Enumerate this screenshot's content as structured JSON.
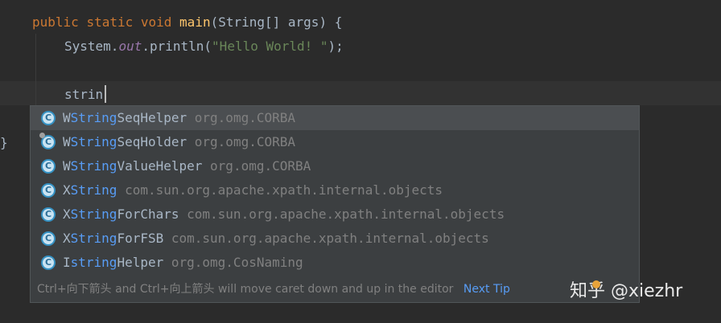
{
  "editor": {
    "line1": {
      "kw1": "public",
      "kw2": "static",
      "kw3": "void",
      "method": "main",
      "rest": "(String[] args) {"
    },
    "line2": {
      "prefix": "System.",
      "field": "out",
      "call": ".println(",
      "string": "\"Hello World! \"",
      "suffix": ");"
    },
    "line4": {
      "typed": "strin"
    },
    "line6": {
      "brace": "}"
    }
  },
  "completion": {
    "items": [
      {
        "prefix": "W",
        "match": "String",
        "suffix": "SeqHelper",
        "package": "org.omg.CORBA",
        "icon": "class-icon"
      },
      {
        "prefix": "W",
        "match": "String",
        "suffix": "SeqHolder",
        "package": "org.omg.CORBA",
        "icon": "class-icon-pinned"
      },
      {
        "prefix": "W",
        "match": "String",
        "suffix": "ValueHelper",
        "package": "org.omg.CORBA",
        "icon": "class-icon"
      },
      {
        "prefix": "X",
        "match": "String",
        "suffix": "",
        "package": "com.sun.org.apache.xpath.internal.objects",
        "icon": "class-icon"
      },
      {
        "prefix": "X",
        "match": "String",
        "suffix": "ForChars",
        "package": "com.sun.org.apache.xpath.internal.objects",
        "icon": "class-icon"
      },
      {
        "prefix": "X",
        "match": "String",
        "suffix": "ForFSB",
        "package": "com.sun.org.apache.xpath.internal.objects",
        "icon": "class-icon"
      },
      {
        "prefix": "I",
        "match": "string",
        "suffix": "Helper",
        "package": "org.omg.CosNaming",
        "icon": "class-icon"
      }
    ],
    "icon_letter": "C",
    "hint": "Ctrl+向下箭头 and Ctrl+向上箭头 will move caret down and up in the editor",
    "next_tip": "Next Tip"
  },
  "watermark": {
    "brand": "知乎",
    "user": "@xiezhr"
  },
  "colors": {
    "background": "#2b2b2b",
    "popup": "#3c3f41",
    "keyword": "#cc7832",
    "match": "#589df6",
    "string": "#6a8759"
  }
}
